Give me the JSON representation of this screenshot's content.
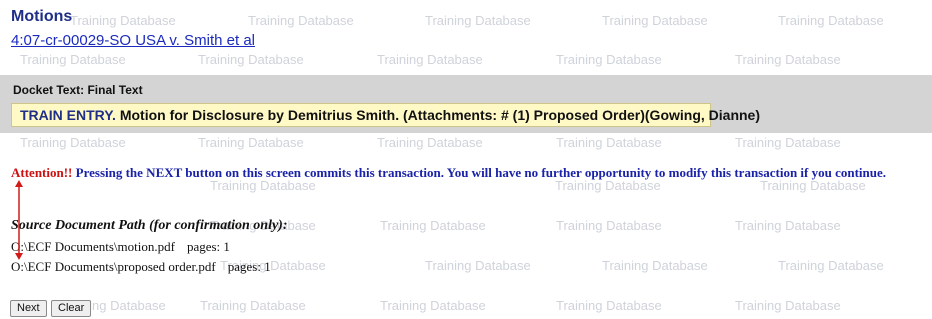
{
  "watermark": "Training Database",
  "header": {
    "title": "Motions",
    "case_link": "4:07-cr-00029-SO USA v. Smith et al"
  },
  "docket": {
    "label": "Docket Text: Final Text",
    "entry_prefix": "TRAIN ENTRY.",
    "entry_text": " Motion for Disclosure by Demitrius Smith. (Attachments: # (1) Proposed Order)(Gowing, Dianne)"
  },
  "attention": {
    "word": "Attention!!",
    "message": " Pressing the NEXT button on this screen commits this transaction. You will have no further opportunity to modify this transaction if you continue."
  },
  "source": {
    "label": "Source Document Path (for confirmation only):",
    "files": [
      {
        "path": "O:\\ECF Documents\\motion.pdf",
        "pages": "pages: 1"
      },
      {
        "path": "O:\\ECF Documents\\proposed order.pdf",
        "pages": "pages: 1"
      }
    ]
  },
  "buttons": {
    "next": "Next",
    "clear": "Clear"
  },
  "colors": {
    "title": "#1f2f87",
    "link": "#1b2bbd",
    "band": "#d4d4d4",
    "docket_box": "#fff9c6",
    "attention_red": "#cc1111",
    "attention_blue": "#1a23a8",
    "arrow_red": "#d11a1a"
  }
}
